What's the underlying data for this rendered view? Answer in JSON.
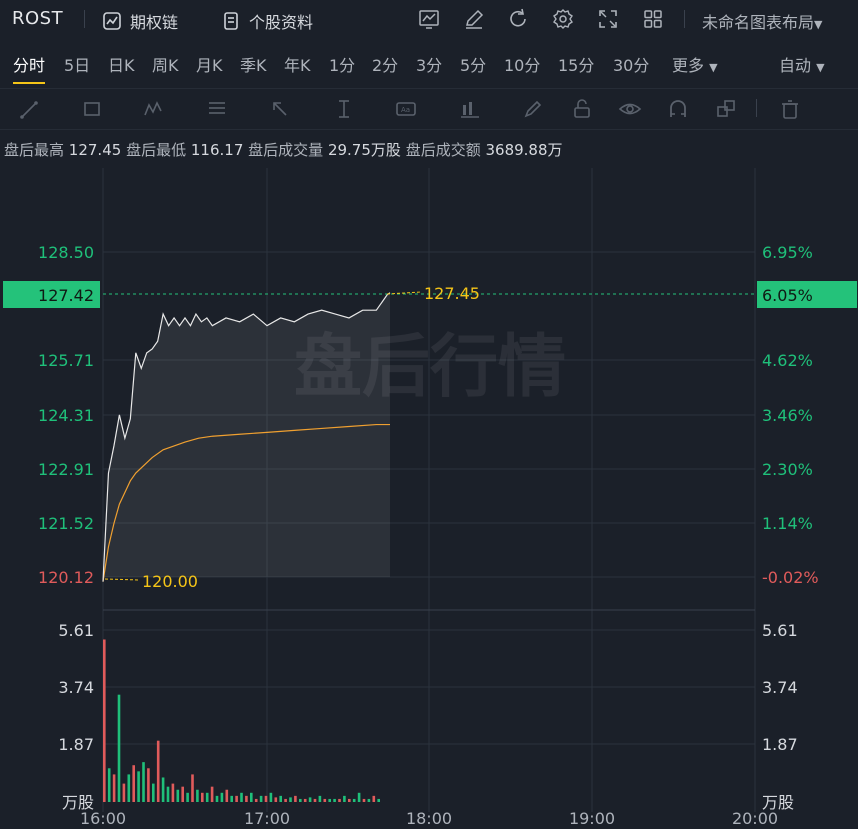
{
  "header": {
    "ticker": "ROST",
    "options_chain_label": "期权链",
    "stock_info_label": "个股资料",
    "layout_label": "未命名图表布局"
  },
  "periods": [
    "分时",
    "5日",
    "日K",
    "周K",
    "月K",
    "季K",
    "年K",
    "1分",
    "2分",
    "3分",
    "5分",
    "10分",
    "15分",
    "30分",
    "更多"
  ],
  "active_period": "分时",
  "auto_label": "自动",
  "stats": {
    "high_label": "盘后最高",
    "high_value": "127.45",
    "low_label": "盘后最低",
    "low_value": "116.17",
    "volume_label": "盘后成交量",
    "volume_value": "29.75万股",
    "amount_label": "盘后成交额",
    "amount_value": "3689.88万"
  },
  "watermark": "盘后行情",
  "colors": {
    "up": "#1fc07a",
    "down": "#e05b5b",
    "price_line": "#e8e8e8",
    "avg_line": "#f0a030",
    "accent": "#f5c518",
    "current_badge": "#24c27a"
  },
  "chart_data": {
    "type": "line",
    "x_ticks": [
      "16:00",
      "17:00",
      "18:00",
      "19:00",
      "20:00"
    ],
    "price_axis_left": [
      "128.50",
      "127.42",
      "125.71",
      "124.31",
      "122.91",
      "121.52",
      "120.12"
    ],
    "price_axis_right": [
      "6.95%",
      "6.05%",
      "4.62%",
      "3.46%",
      "2.30%",
      "1.14%",
      "-0.02%"
    ],
    "current_price": "127.42",
    "current_pct": "6.05%",
    "max_label": "127.45",
    "min_label": "120.00",
    "ylim": [
      120.12,
      128.5
    ],
    "series": [
      {
        "name": "price",
        "x": [
          0,
          2,
          4,
          6,
          8,
          10,
          12,
          14,
          16,
          18,
          20,
          22,
          24,
          26,
          28,
          30,
          32,
          34,
          36,
          38,
          40,
          45,
          50,
          55,
          60,
          65,
          70,
          75,
          80,
          85,
          90,
          95,
          100,
          104,
          105
        ],
        "values": [
          120.0,
          122.8,
          123.5,
          124.3,
          123.7,
          124.2,
          125.9,
          125.5,
          125.9,
          126.0,
          126.2,
          126.9,
          126.6,
          126.8,
          126.6,
          126.8,
          126.6,
          126.9,
          126.7,
          126.8,
          126.6,
          126.8,
          126.7,
          126.9,
          126.6,
          126.8,
          126.7,
          126.9,
          127.0,
          126.9,
          126.8,
          127.0,
          127.0,
          127.4,
          127.45
        ]
      },
      {
        "name": "avg",
        "x": [
          0,
          2,
          4,
          6,
          8,
          10,
          12,
          15,
          18,
          22,
          26,
          30,
          35,
          40,
          50,
          60,
          70,
          80,
          90,
          100,
          105
        ],
        "values": [
          120.0,
          120.9,
          121.5,
          122.0,
          122.3,
          122.6,
          122.8,
          123.0,
          123.2,
          123.4,
          123.5,
          123.6,
          123.7,
          123.75,
          123.8,
          123.85,
          123.9,
          123.95,
          124.0,
          124.05,
          124.05
        ]
      }
    ],
    "volume": {
      "axis_labels": [
        "5.61",
        "3.74",
        "1.87"
      ],
      "unit": "万股",
      "ymax": 5.61,
      "bars": [
        5.3,
        1.1,
        0.9,
        3.5,
        0.6,
        0.9,
        1.2,
        1.0,
        1.3,
        1.1,
        0.6,
        2.0,
        0.8,
        0.5,
        0.6,
        0.4,
        0.5,
        0.3,
        0.9,
        0.4,
        0.3,
        0.3,
        0.5,
        0.2,
        0.3,
        0.4,
        0.2,
        0.2,
        0.3,
        0.2,
        0.3,
        0.1,
        0.2,
        0.2,
        0.3,
        0.15,
        0.2,
        0.1,
        0.15,
        0.2,
        0.1,
        0.1,
        0.15,
        0.1,
        0.2,
        0.1,
        0.1,
        0.1,
        0.1,
        0.2,
        0.1,
        0.1,
        0.3,
        0.1,
        0.1,
        0.2,
        0.1
      ],
      "bar_colors": [
        "down",
        "up",
        "down",
        "up",
        "down",
        "up",
        "down",
        "up",
        "up",
        "down",
        "up",
        "down",
        "up",
        "up",
        "down",
        "up",
        "down",
        "up",
        "down",
        "up",
        "down",
        "up",
        "down",
        "up",
        "up",
        "down",
        "up",
        "down",
        "up",
        "down",
        "up",
        "down",
        "up",
        "down",
        "up",
        "down",
        "up",
        "down",
        "up",
        "down",
        "up",
        "down",
        "up",
        "down",
        "up",
        "down",
        "up",
        "up",
        "down",
        "up",
        "down",
        "up",
        "up",
        "down",
        "up",
        "down",
        "up"
      ]
    }
  }
}
